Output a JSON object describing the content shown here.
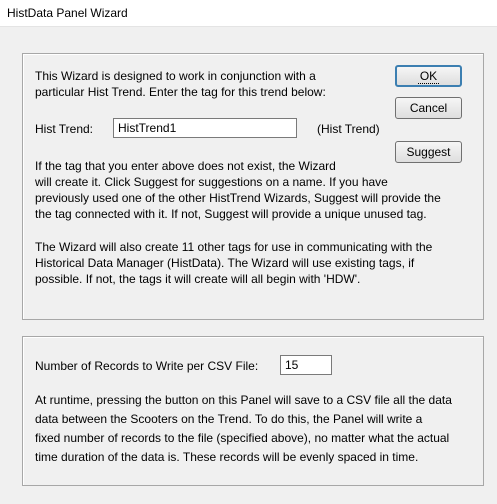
{
  "window": {
    "title": "HistData Panel Wizard"
  },
  "top_section": {
    "intro_line1": "This Wizard is designed to work in conjunction with a",
    "intro_line2": "particular Hist Trend.  Enter the tag for this trend below:",
    "hist_trend_label": "Hist Trend:",
    "hist_trend_value": "HistTrend1",
    "hist_trend_type": "(Hist Trend)",
    "suggest_text": "If the tag that you enter above does not exist, the Wizard\nwill create it.  Click Suggest for suggestions on a name.  If you have\npreviously used one of the other HistTrend Wizards, Suggest will provide the\nthe tag connected with it.  If not, Suggest will provide a unique unused tag.",
    "tags_text": "The Wizard will also create 11 other tags for use in communicating with the\nHistorical Data Manager (HistData).  The Wizard will use existing tags, if\npossible.  If not, the tags it will create will all begin with 'HDW'."
  },
  "buttons": {
    "ok": "OK",
    "cancel": "Cancel",
    "suggest": "Suggest"
  },
  "bottom_section": {
    "records_label": "Number of Records to Write per CSV File:",
    "records_value": "15",
    "runtime_text": "At runtime, pressing the button on this Panel will save to a CSV file all the data\ndata between the Scooters on the Trend. To do this, the Panel will write a\nfixed number of records to the file (specified above), no matter what the actual\ntime duration of the data is.  These records will be evenly spaced in time."
  }
}
